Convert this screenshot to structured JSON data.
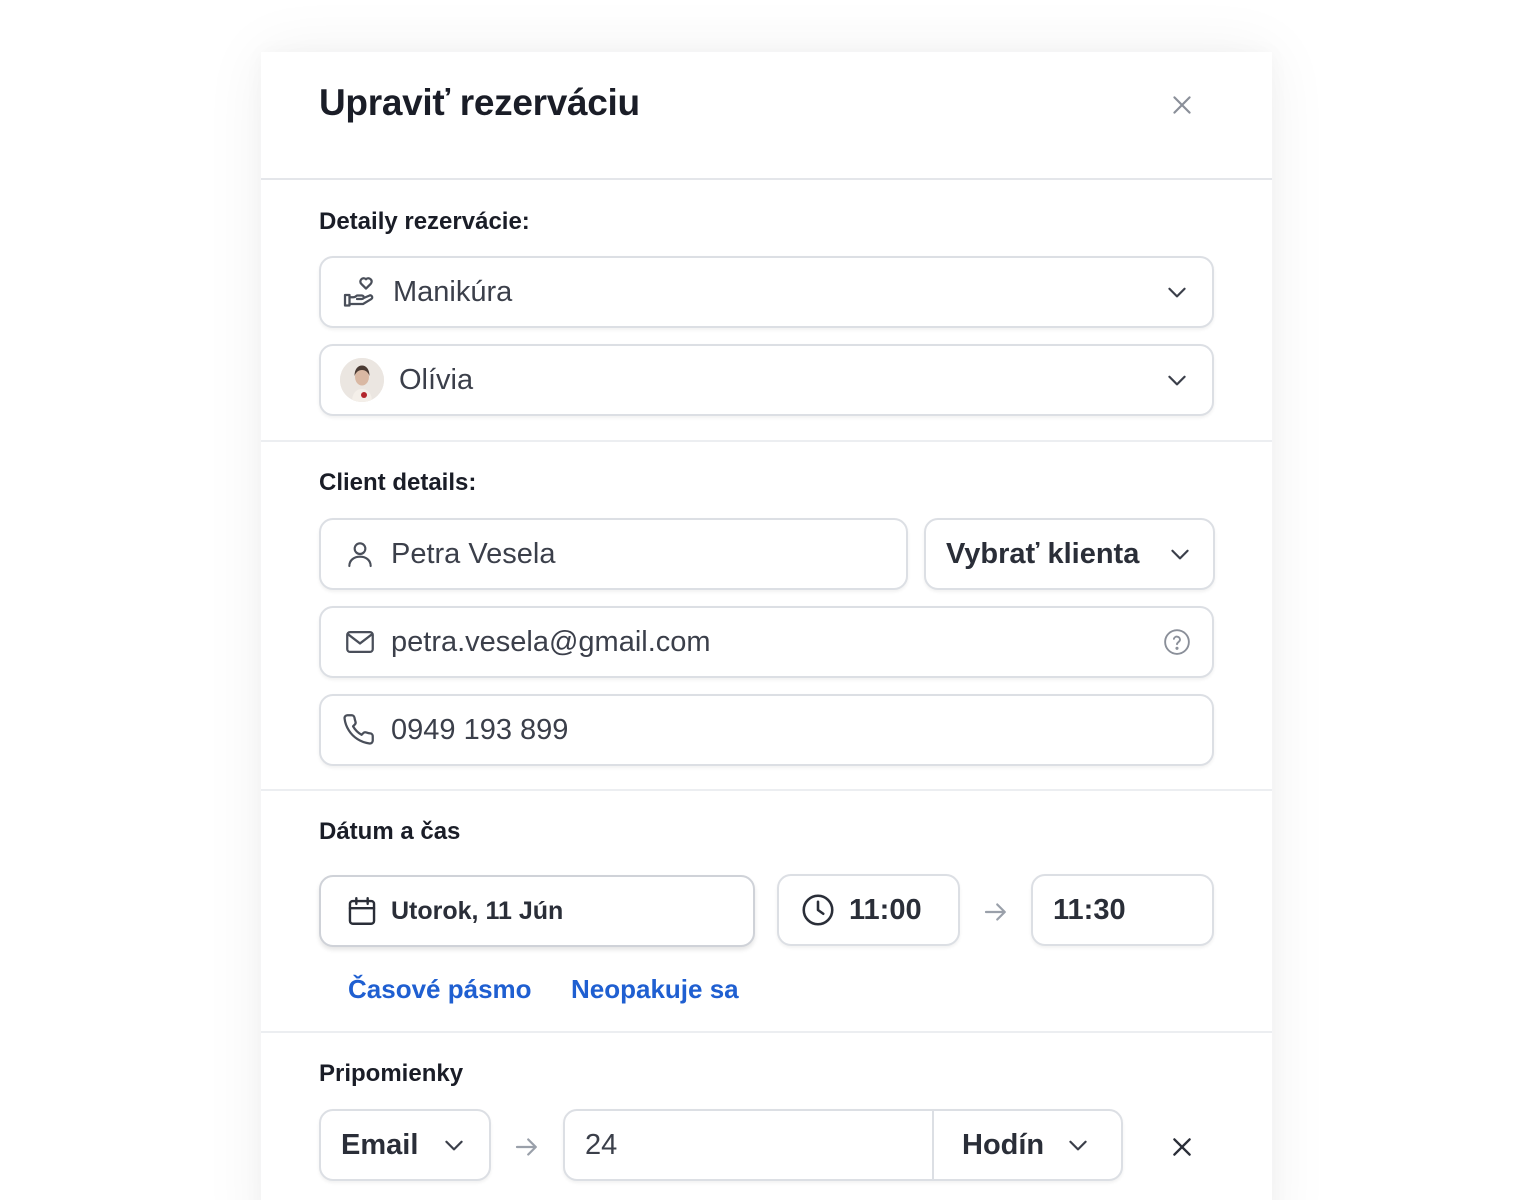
{
  "modal": {
    "title": "Upraviť rezerváciu"
  },
  "booking": {
    "section_title": "Detaily rezervácie:",
    "service": "Manikúra",
    "staff": "Olívia"
  },
  "client": {
    "section_title": "Client details:",
    "name": "Petra Vesela",
    "select_label": "Vybrať klienta",
    "email": "petra.vesela@gmail.com",
    "phone": "0949 193 899"
  },
  "datetime": {
    "section_title": "Dátum a čas",
    "date": "Utorok, 11 Jún",
    "start_time": "11:00",
    "end_time": "11:30",
    "timezone_link": "Časové pásmo",
    "repeat_link": "Neopakuje sa"
  },
  "reminders": {
    "section_title": "Pripomienky",
    "channel": "Email",
    "amount": "24",
    "unit": "Hodín"
  },
  "colors": {
    "accent_link": "#1f5fd1",
    "border": "#dcdfe4",
    "text": "#1a1d27"
  }
}
